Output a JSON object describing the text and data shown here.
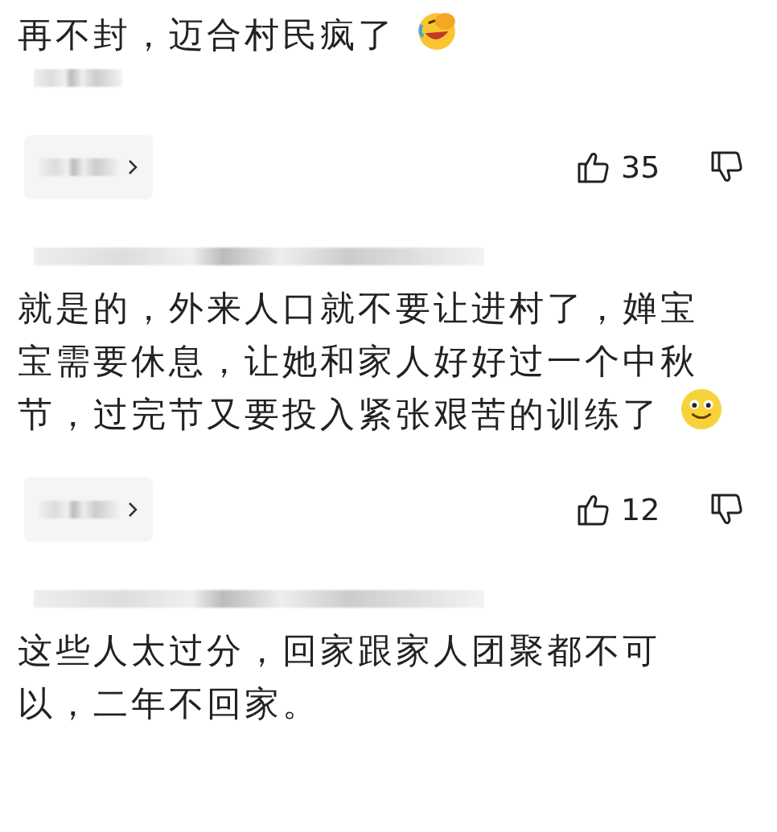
{
  "comments": [
    {
      "text": "再不封，迈合村民疯了",
      "emoji": {
        "kind": "laughing-facepalm"
      },
      "likes": "35"
    },
    {
      "text": "就是的，外来人口就不要让进村了，婵宝宝需要休息，让她和家人好好过一个中秋节，过完节又要投入紧张艰苦的训练了",
      "emoji": {
        "kind": "smile"
      },
      "likes": "12"
    },
    {
      "text": "这些人太过分，回家跟家人团聚都不可以，二年不回家。"
    }
  ]
}
